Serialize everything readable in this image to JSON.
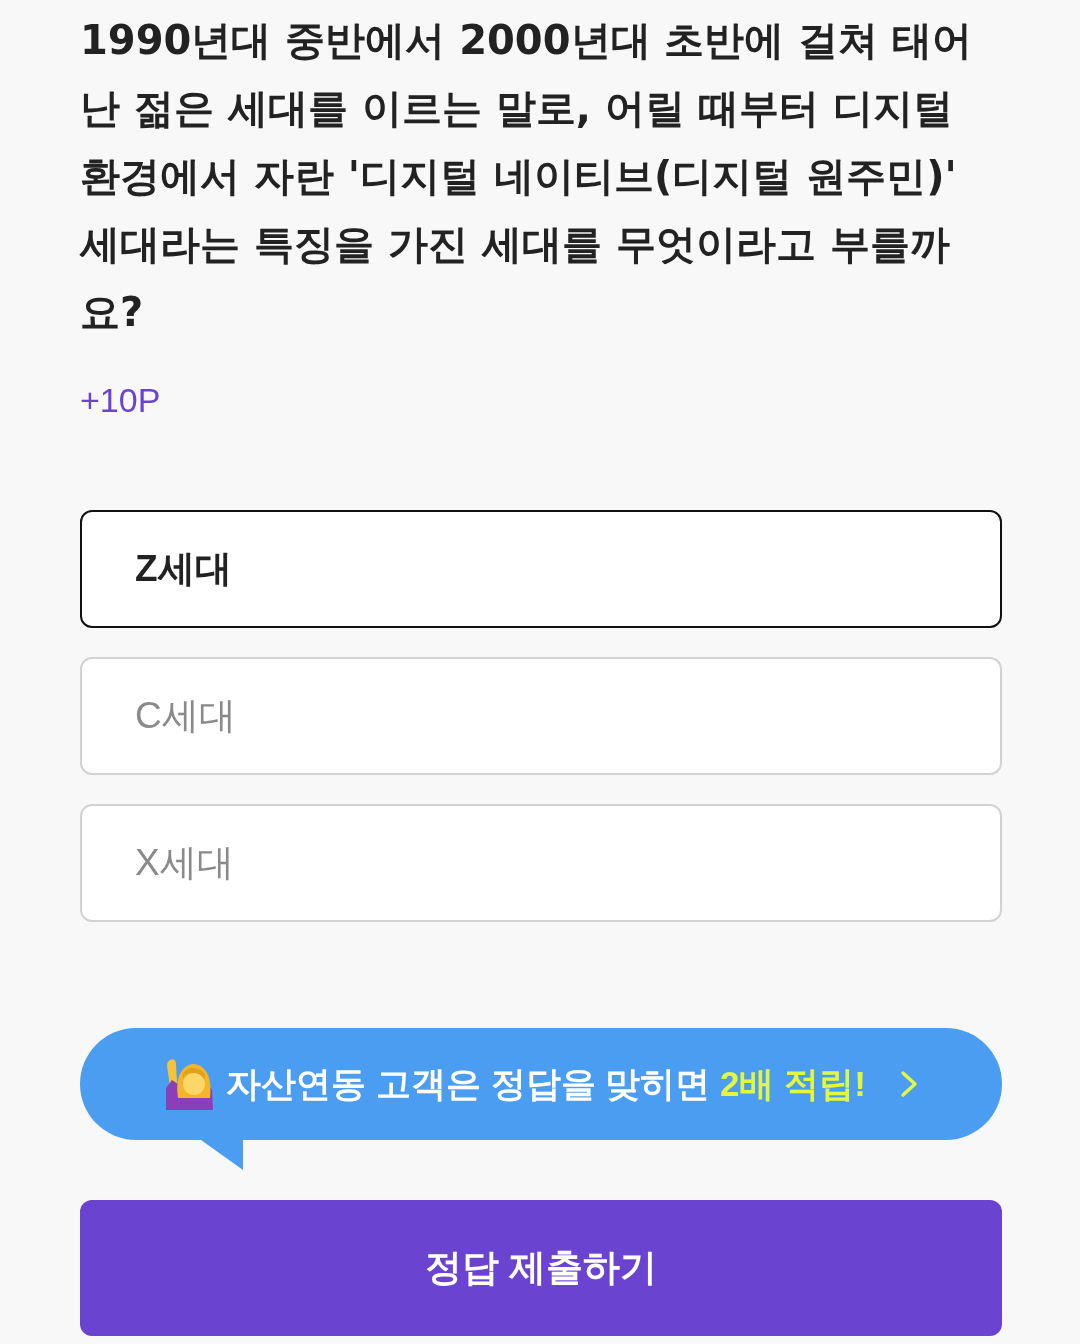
{
  "question": {
    "text": "1990년대 중반에서 2000년대 초반에 걸쳐 태어난 젊은 세대를 이르는 말로, 어릴 때부터 디지털 환경에서 자란 '디지털 네이티브(디지털 원주민)' 세대라는 특징을 가진 세대를 무엇이라고 부를까요?",
    "points": "+10P"
  },
  "options": [
    {
      "label": "Z세대",
      "selected": true
    },
    {
      "label": "C세대",
      "selected": false
    },
    {
      "label": "X세대",
      "selected": false
    }
  ],
  "promo_banner": {
    "text": "자산연동 고객은 정답을 맞히면 **2배 적립!**"
  },
  "submit_button": {
    "label": "정답 제출하기"
  }
}
